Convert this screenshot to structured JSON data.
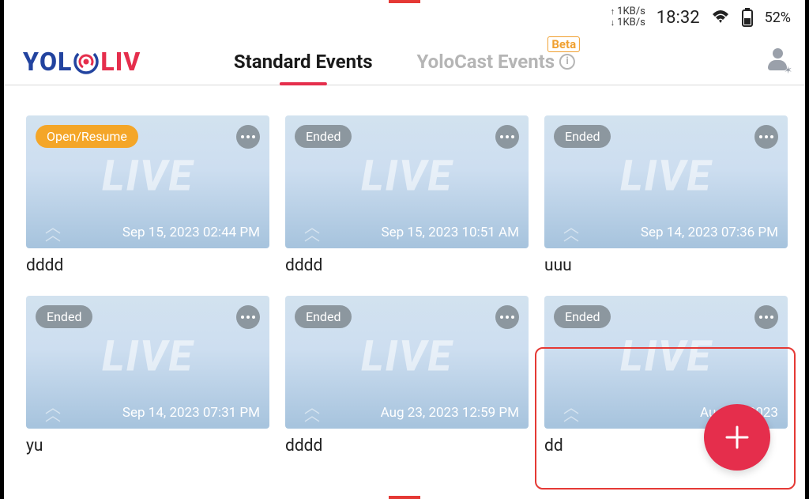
{
  "status_bar": {
    "upload_speed": "1KB/s",
    "download_speed": "1KB/s",
    "time": "18:32",
    "battery_percent": "52%"
  },
  "header": {
    "logo_text": {
      "p1": "YOL",
      "p2": "LIV"
    },
    "tabs": [
      {
        "label": "Standard Events",
        "active": true
      },
      {
        "label": "YoloCast Events",
        "active": false,
        "badge": "Beta"
      }
    ]
  },
  "status_labels": {
    "open": "Open/Resume",
    "ended": "Ended"
  },
  "events": [
    {
      "status": "open",
      "datetime": "Sep 15, 2023 02:44 PM",
      "title": "dddd"
    },
    {
      "status": "ended",
      "datetime": "Sep 15, 2023 10:51 AM",
      "title": "dddd"
    },
    {
      "status": "ended",
      "datetime": "Sep 14, 2023 07:36 PM",
      "title": "uuu"
    },
    {
      "status": "ended",
      "datetime": "Sep 14, 2023 07:31 PM",
      "title": "yu"
    },
    {
      "status": "ended",
      "datetime": "Aug 23, 2023 12:59 PM",
      "title": "dddd"
    },
    {
      "status": "ended",
      "datetime": "Aug 10, 2023",
      "title": "dd"
    }
  ]
}
